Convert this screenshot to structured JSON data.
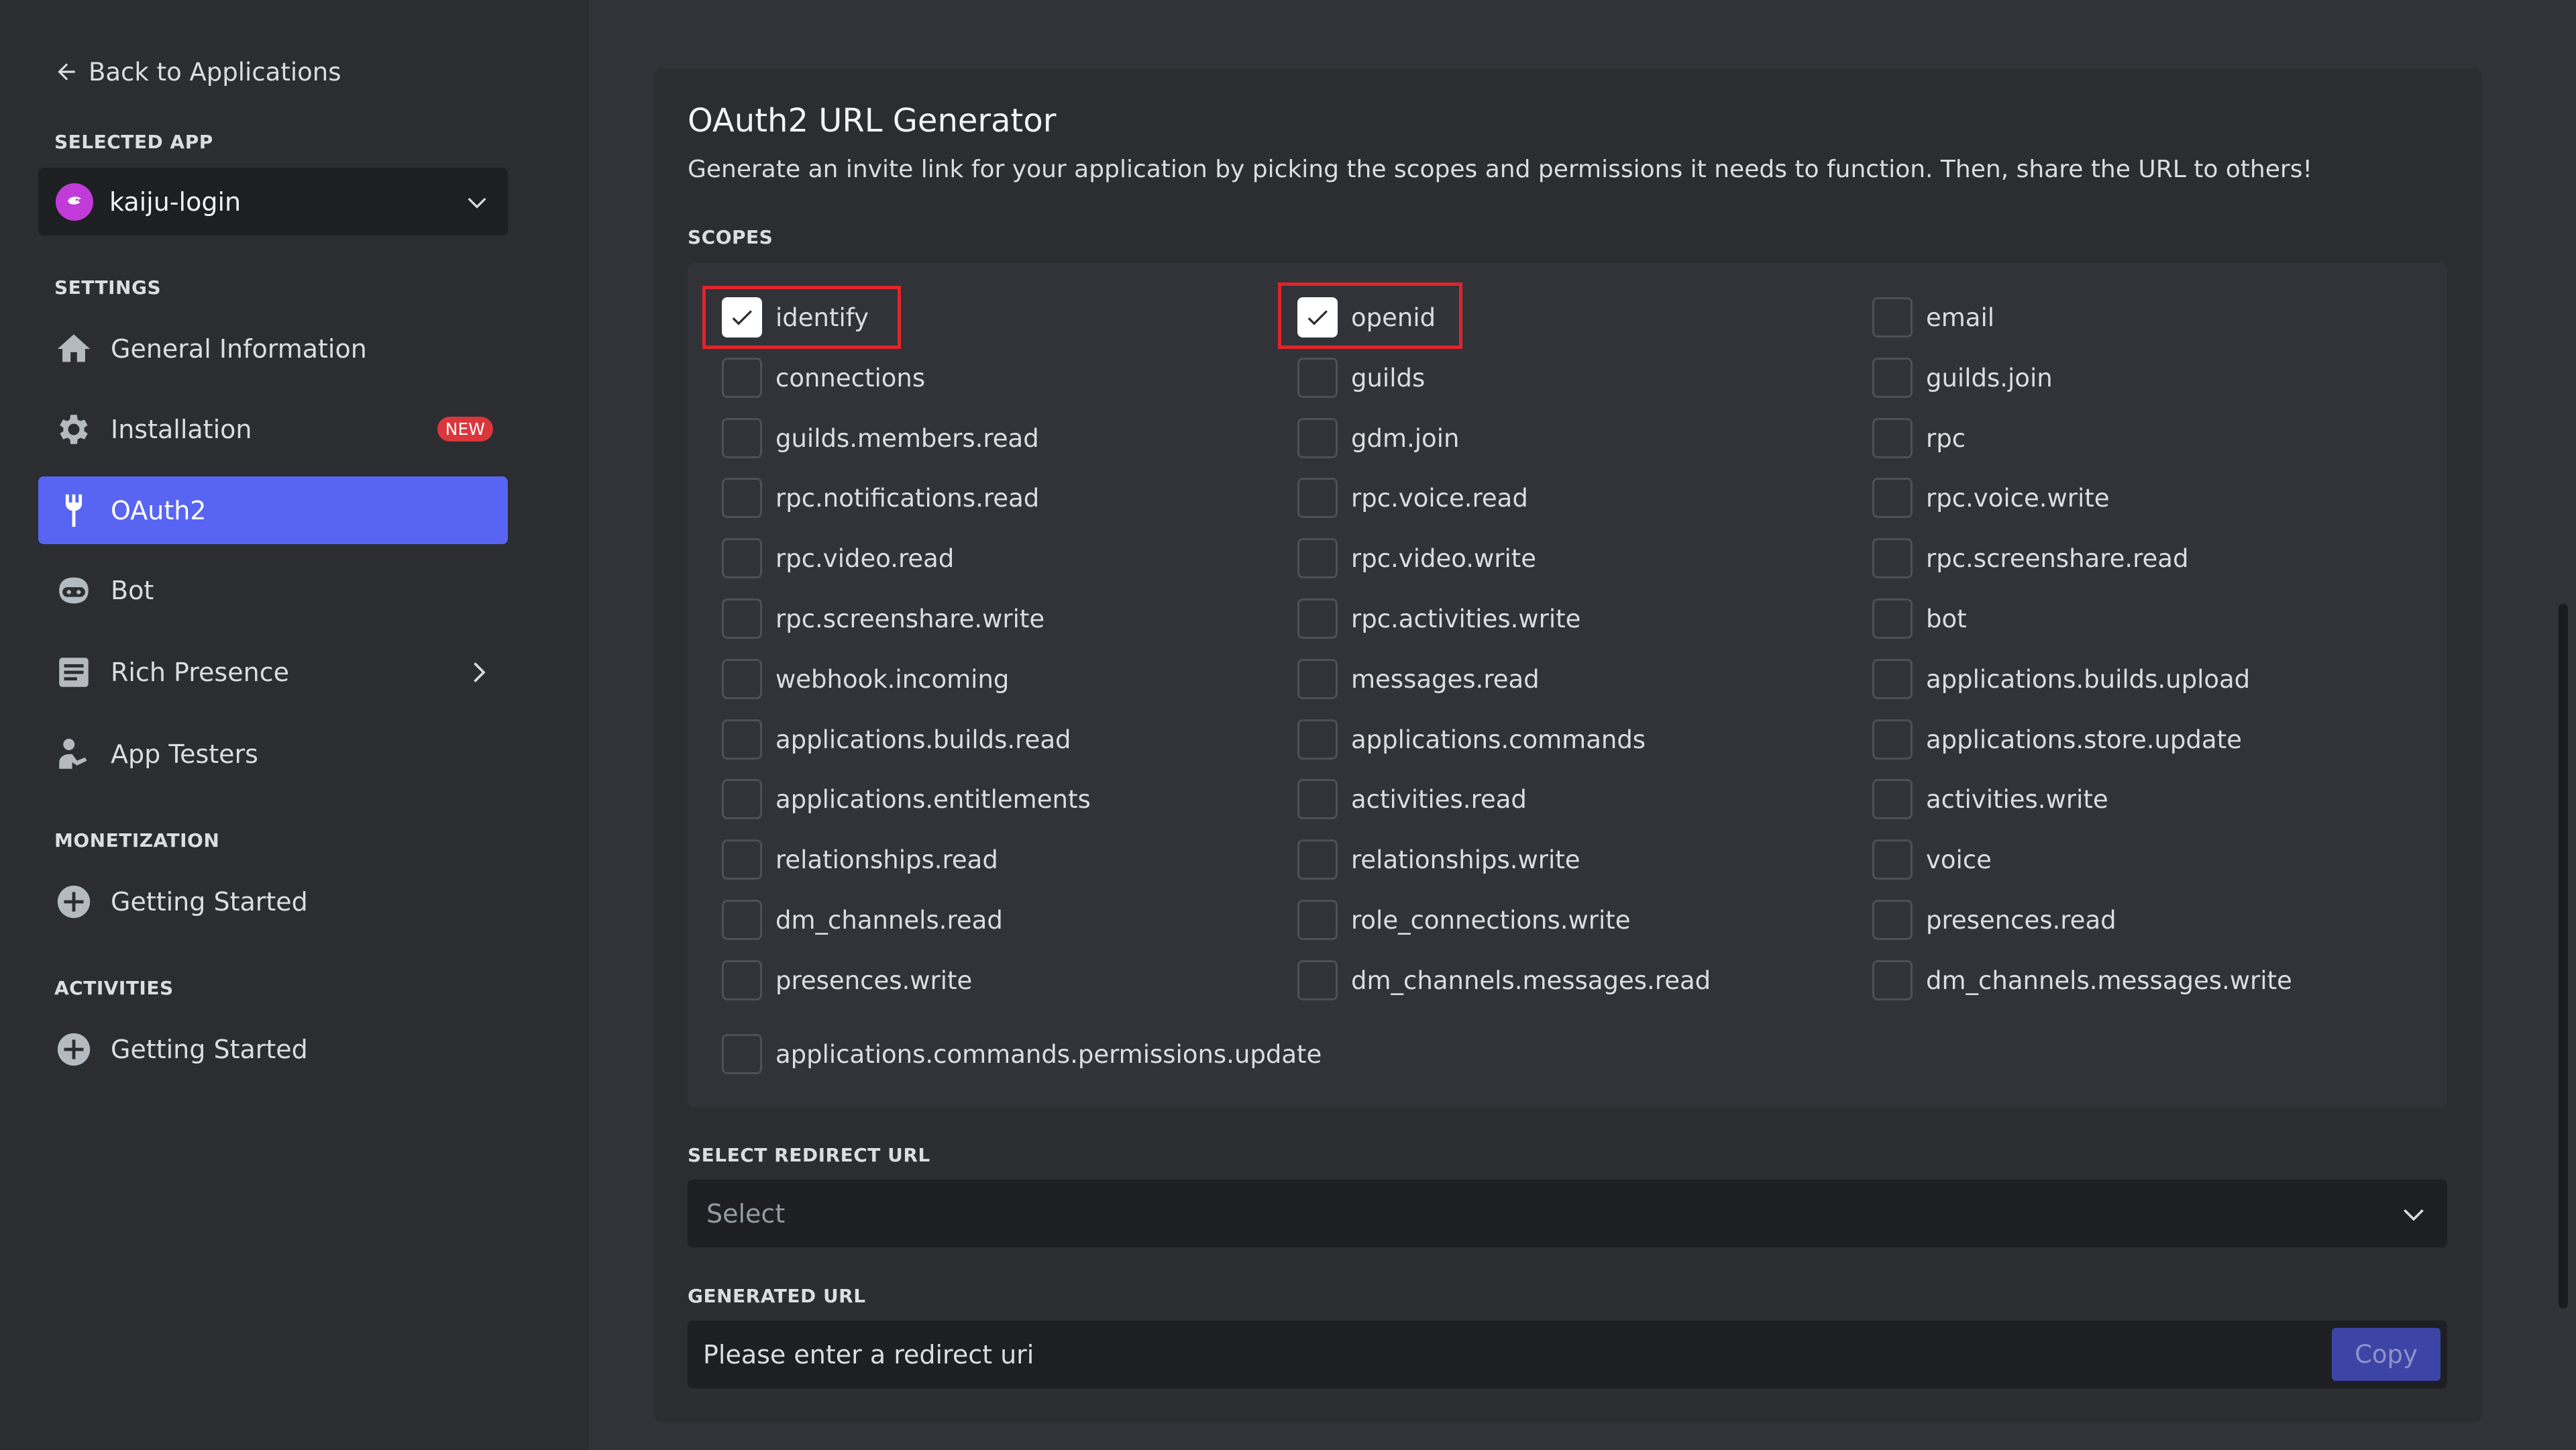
{
  "sidebar": {
    "back_label": "Back to Applications",
    "selected_app_header": "SELECTED APP",
    "app_name": "kaiju-login",
    "settings_header": "SETTINGS",
    "items": [
      {
        "label": "General Information"
      },
      {
        "label": "Installation",
        "badge": "NEW"
      },
      {
        "label": "OAuth2",
        "active": true
      },
      {
        "label": "Bot"
      },
      {
        "label": "Rich Presence"
      },
      {
        "label": "App Testers"
      }
    ],
    "monetization_header": "MONETIZATION",
    "monetization_item": "Getting Started",
    "activities_header": "ACTIVITIES",
    "activities_item": "Getting Started"
  },
  "main": {
    "title": "OAuth2 URL Generator",
    "description": "Generate an invite link for your application by picking the scopes and permissions it needs to function. Then, share the URL to others!",
    "scopes_header": "SCOPES",
    "scopes": [
      {
        "label": "identify",
        "checked": true
      },
      {
        "label": "openid",
        "checked": true
      },
      {
        "label": "email",
        "checked": false
      },
      {
        "label": "connections",
        "checked": false
      },
      {
        "label": "guilds",
        "checked": false
      },
      {
        "label": "guilds.join",
        "checked": false
      },
      {
        "label": "guilds.members.read",
        "checked": false
      },
      {
        "label": "gdm.join",
        "checked": false
      },
      {
        "label": "rpc",
        "checked": false
      },
      {
        "label": "rpc.notifications.read",
        "checked": false
      },
      {
        "label": "rpc.voice.read",
        "checked": false
      },
      {
        "label": "rpc.voice.write",
        "checked": false
      },
      {
        "label": "rpc.video.read",
        "checked": false
      },
      {
        "label": "rpc.video.write",
        "checked": false
      },
      {
        "label": "rpc.screenshare.read",
        "checked": false
      },
      {
        "label": "rpc.screenshare.write",
        "checked": false
      },
      {
        "label": "rpc.activities.write",
        "checked": false
      },
      {
        "label": "bot",
        "checked": false
      },
      {
        "label": "webhook.incoming",
        "checked": false
      },
      {
        "label": "messages.read",
        "checked": false
      },
      {
        "label": "applications.builds.upload",
        "checked": false
      },
      {
        "label": "applications.builds.read",
        "checked": false
      },
      {
        "label": "applications.commands",
        "checked": false
      },
      {
        "label": "applications.store.update",
        "checked": false
      },
      {
        "label": "applications.entitlements",
        "checked": false
      },
      {
        "label": "activities.read",
        "checked": false
      },
      {
        "label": "activities.write",
        "checked": false
      },
      {
        "label": "relationships.read",
        "checked": false
      },
      {
        "label": "relationships.write",
        "checked": false
      },
      {
        "label": "voice",
        "checked": false
      },
      {
        "label": "dm_channels.read",
        "checked": false
      },
      {
        "label": "role_connections.write",
        "checked": false
      },
      {
        "label": "presences.read",
        "checked": false
      },
      {
        "label": "presences.write",
        "checked": false
      },
      {
        "label": "dm_channels.messages.read",
        "checked": false
      },
      {
        "label": "dm_channels.messages.write",
        "checked": false
      },
      {
        "label": "applications.commands.permissions.update",
        "checked": false
      }
    ],
    "redirect_header": "SELECT REDIRECT URL",
    "redirect_placeholder": "Select",
    "generated_header": "GENERATED URL",
    "generated_text": "Please enter a redirect uri",
    "copy_label": "Copy"
  },
  "colors": {
    "background": "#313338",
    "sidebar": "#2b2d31",
    "accent": "#5865f2",
    "highlight": "#e0242b",
    "badge": "#da373c"
  }
}
